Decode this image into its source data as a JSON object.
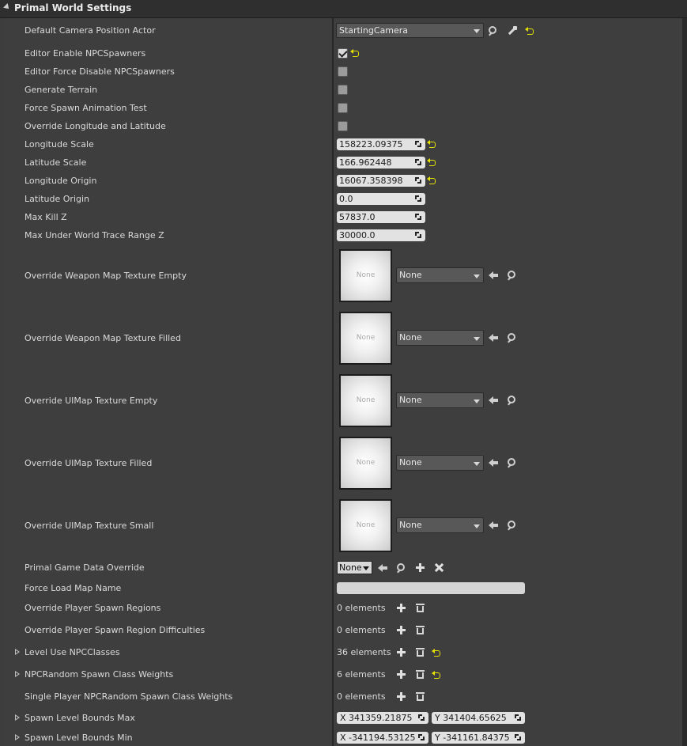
{
  "panel": {
    "title": "Primal World Settings"
  },
  "rows": {
    "default_camera_actor": {
      "label": "Default Camera Position Actor",
      "value": "StartingCamera"
    },
    "editor_enable_npc_spawners": {
      "label": "Editor Enable NPCSpawners",
      "checked": true
    },
    "editor_force_disable_npc_spawners": {
      "label": "Editor Force Disable NPCSpawners",
      "checked": false
    },
    "generate_terrain": {
      "label": "Generate Terrain",
      "checked": false
    },
    "force_spawn_animation_test": {
      "label": "Force Spawn Animation Test",
      "checked": false
    },
    "override_long_lat": {
      "label": "Override Longitude and Latitude",
      "checked": false
    },
    "longitude_scale": {
      "label": "Longitude Scale",
      "value": "158223.09375"
    },
    "latitude_scale": {
      "label": "Latitude Scale",
      "value": "166.962448"
    },
    "longitude_origin": {
      "label": "Longitude Origin",
      "value": "16067.358398"
    },
    "latitude_origin": {
      "label": "Latitude Origin",
      "value": "0.0"
    },
    "max_kill_z": {
      "label": "Max Kill Z",
      "value": "57837.0"
    },
    "max_under_world_trace": {
      "label": "Max Under World Trace Range Z",
      "value": "30000.0"
    },
    "weapon_map_empty": {
      "label": "Override Weapon Map Texture Empty",
      "thumb": "None",
      "value": "None"
    },
    "weapon_map_filled": {
      "label": "Override Weapon Map Texture Filled",
      "thumb": "None",
      "value": "None"
    },
    "uimap_empty": {
      "label": "Override UIMap Texture Empty",
      "thumb": "None",
      "value": "None"
    },
    "uimap_filled": {
      "label": "Override UIMap Texture Filled",
      "thumb": "None",
      "value": "None"
    },
    "uimap_small": {
      "label": "Override UIMap Texture Small",
      "thumb": "None",
      "value": "None"
    },
    "primal_game_data_override": {
      "label": "Primal Game Data Override",
      "value": "None"
    },
    "force_load_map_name": {
      "label": "Force Load Map Name",
      "value": ""
    },
    "override_player_spawn_regions": {
      "label": "Override Player Spawn Regions",
      "value": "0 elements"
    },
    "override_player_spawn_region_difficulties": {
      "label": "Override Player Spawn Region Difficulties",
      "value": "0 elements"
    },
    "level_use_npc_classes": {
      "label": "Level Use NPCClasses",
      "value": "36 elements"
    },
    "npc_random_spawn_class_weights": {
      "label": "NPCRandom Spawn Class Weights",
      "value": "6 elements"
    },
    "single_player_npc_random_spawn_class_weights": {
      "label": "Single Player NPCRandom Spawn Class Weights",
      "value": "0 elements"
    },
    "spawn_level_bounds_max": {
      "label": "Spawn Level Bounds Max",
      "x": "X  341359.21875",
      "y": "Y  341404.65625"
    },
    "spawn_level_bounds_min": {
      "label": "Spawn Level Bounds Min",
      "x": "X  -341194.53125",
      "y": "Y  -341161.84375"
    }
  },
  "colors": {
    "reset_arrow": "#e6e200",
    "panel_bg": "#3e3e3e",
    "header_bg": "#2f2f2f"
  }
}
